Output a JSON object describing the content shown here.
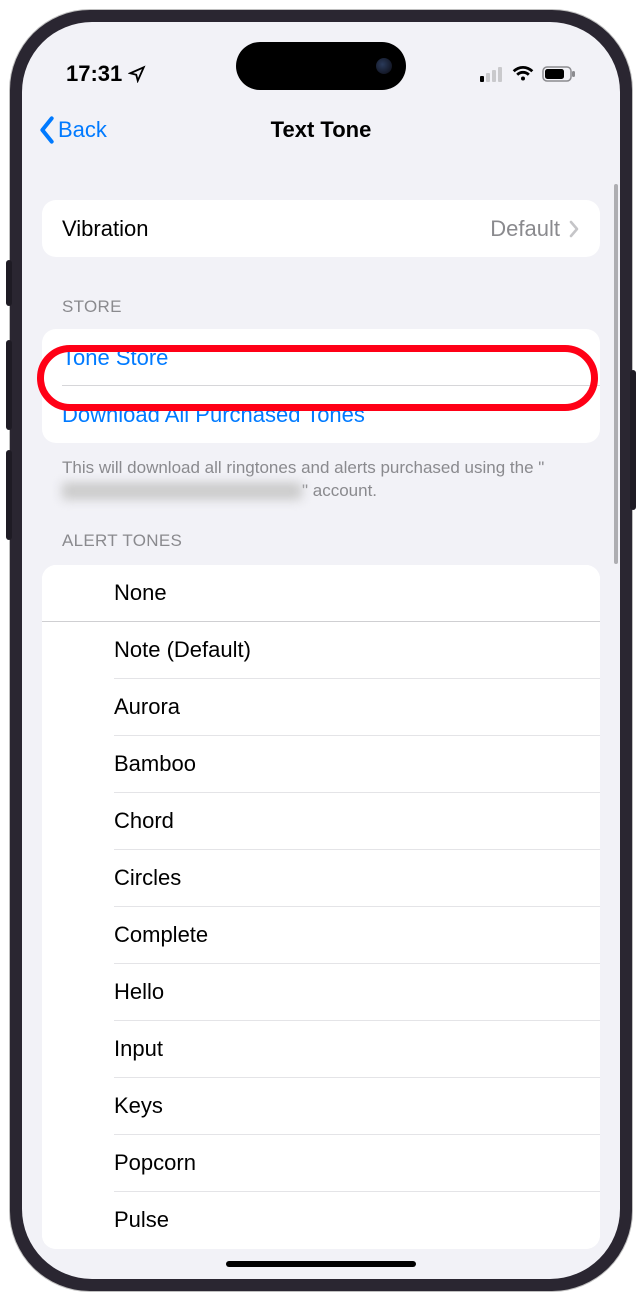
{
  "statusBar": {
    "time": "17:31"
  },
  "nav": {
    "back": "Back",
    "title": "Text Tone"
  },
  "vibration": {
    "label": "Vibration",
    "value": "Default"
  },
  "storeSection": {
    "header": "Store",
    "toneStore": "Tone Store",
    "downloadAll": "Download All Purchased Tones",
    "footerPrefix": "This will download all ringtones and alerts purchased using the \"",
    "footerSuffix": "\" account."
  },
  "alertTonesHeader": "Alert Tones",
  "alertTones": [
    "None",
    "Note (Default)",
    "Aurora",
    "Bamboo",
    "Chord",
    "Circles",
    "Complete",
    "Hello",
    "Input",
    "Keys",
    "Popcorn",
    "Pulse"
  ]
}
